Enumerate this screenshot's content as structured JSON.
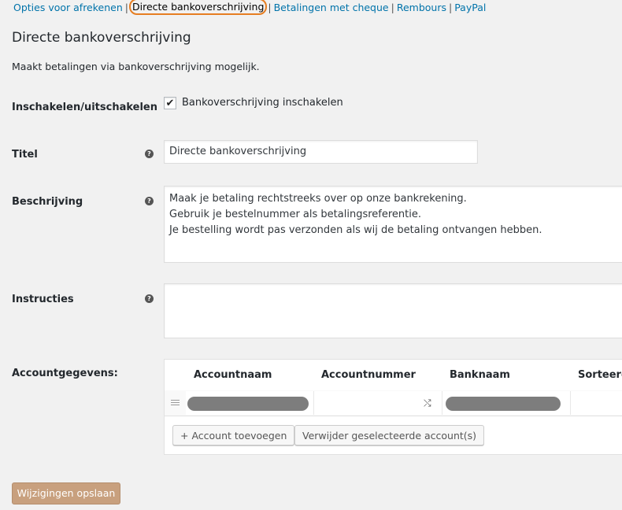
{
  "nav": {
    "items": [
      {
        "label": "Opties voor afrekenen"
      },
      {
        "label": "Directe bankoverschrijving",
        "current": true
      },
      {
        "label": "Betalingen met cheque"
      },
      {
        "label": "Rembours"
      },
      {
        "label": "PayPal"
      }
    ],
    "separator": "|"
  },
  "page": {
    "title": "Directe bankoverschrijving",
    "description": "Maakt betalingen via bankoverschrijving mogelijk."
  },
  "fields": {
    "enable": {
      "label": "Inschakelen/uitschakelen",
      "checkbox_label": "Bankoverschrijving inschakelen",
      "checked": true
    },
    "title": {
      "label": "Titel",
      "value": "Directe bankoverschrijving"
    },
    "description": {
      "label": "Beschrijving",
      "value": "Maak je betaling rechtstreeks over op onze bankrekening.\nGebruik je bestelnummer als betalingsreferentie.\nJe bestelling wordt pas verzonden als wij de betaling ontvangen hebben."
    },
    "instructions": {
      "label": "Instructies",
      "value": ""
    },
    "accounts": {
      "label": "Accountgegevens:",
      "columns": [
        "Accountnaam",
        "Accountnummer",
        "Banknaam",
        "Sorteerco"
      ],
      "add_button": "+ Account toevoegen",
      "remove_button": "Verwijder geselecteerde account(s)"
    }
  },
  "help_icon_glyph": "?",
  "save_button": "Wijzigingen opslaan",
  "colors": {
    "link": "#0073aa",
    "highlight": "#e67e22",
    "save": "#c8a07e"
  }
}
